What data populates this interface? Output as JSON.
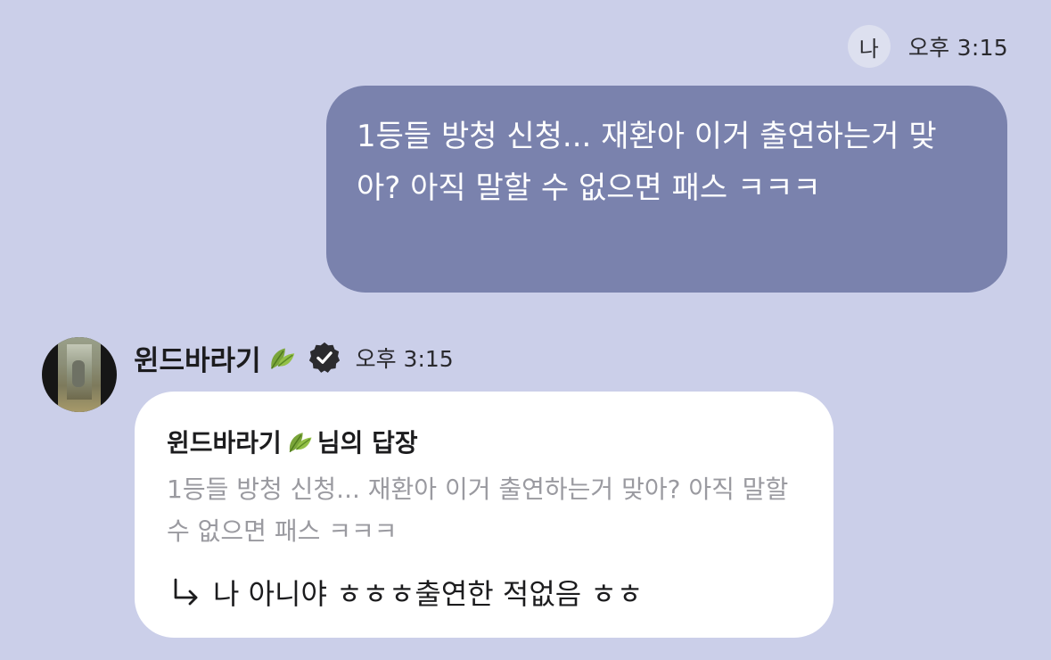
{
  "outgoing": {
    "sender_badge": "나",
    "time": "오후 3:15",
    "text": "1등들 방청 신청... 재환아 이거 출연하는거 맞아? 아직 말할 수 없으면 패스 ㅋㅋㅋ",
    "bubble_color": "#7a82ad"
  },
  "incoming": {
    "sender_name": "윈드바라기",
    "sender_icons": [
      "leaf-icon",
      "verified-icon"
    ],
    "time": "오후 3:15",
    "reply": {
      "quote_title_name": "윈드바라기",
      "quote_title_suffix": "님의 답장",
      "quoted_text": "1등들 방청 신청... 재환아 이거 출연하는거 맞아? 아직 말할 수 없으면 패스 ㅋㅋㅋ",
      "reply_icon": "reply-arrow-icon",
      "reply_text": "나 아니야 ㅎㅎㅎ출연한 적없음 ㅎㅎ"
    }
  },
  "colors": {
    "background": "#cbcfe9",
    "incoming_bubble": "#ffffff",
    "quoted_text": "#9a9aa0"
  }
}
